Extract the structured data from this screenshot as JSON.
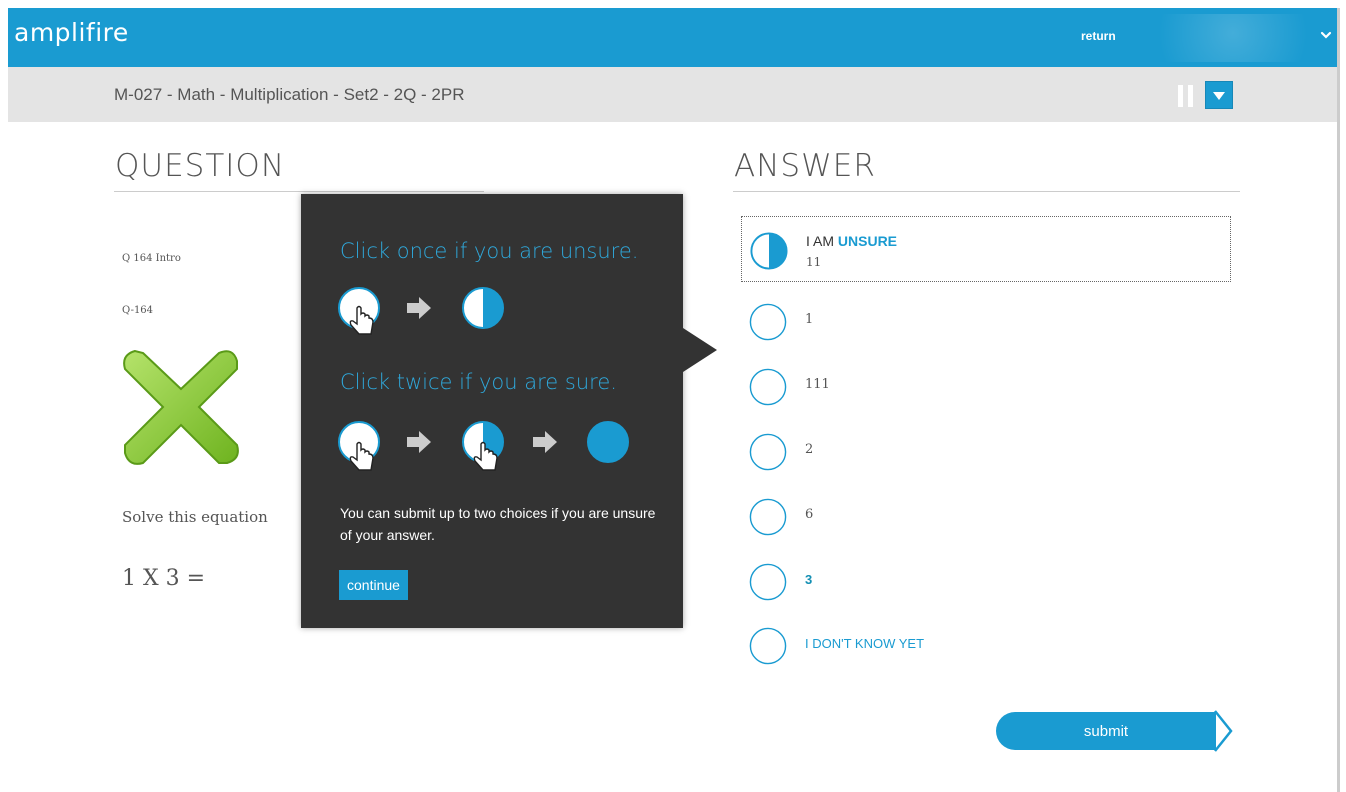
{
  "app": {
    "logo_text": "amplifire",
    "return_label": "return"
  },
  "module": {
    "title": "M-027 - Math - Multiplication - Set2 - 2Q - 2PR"
  },
  "question": {
    "heading": "QUESTION",
    "intro_label": "Q 164 Intro",
    "id_label": "Q-164",
    "prompt": "Solve this equation",
    "equation": "1 X 3 ="
  },
  "tooltip": {
    "once_text": "Click once if you are unsure.",
    "twice_text": "Click twice if you are sure.",
    "note": "You can submit up to two choices if you are unsure of your answer.",
    "continue_label": "continue"
  },
  "answer": {
    "heading": "ANSWER",
    "selected_prefix": "I AM",
    "selected_status": "UNSURE",
    "options": [
      {
        "label": "11",
        "state": "unsure"
      },
      {
        "label": "1",
        "state": "empty"
      },
      {
        "label": "111",
        "state": "empty"
      },
      {
        "label": "2",
        "state": "empty"
      },
      {
        "label": "6",
        "state": "empty"
      },
      {
        "label": "3",
        "state": "empty"
      },
      {
        "label": "I DON'T KNOW YET",
        "state": "empty"
      }
    ],
    "submit_label": "submit"
  },
  "colors": {
    "accent": "#1a9bd1",
    "tooltip_bg": "#333333",
    "subheader_bg": "#e4e4e4",
    "x_green": "#8cc63f"
  },
  "icons": [
    "flame-icon",
    "chevron-down-icon",
    "pause-icon",
    "caret-down-icon",
    "x-mark-icon",
    "hand-cursor-icon",
    "arrow-right-icon",
    "confidence-bubble-icon"
  ]
}
